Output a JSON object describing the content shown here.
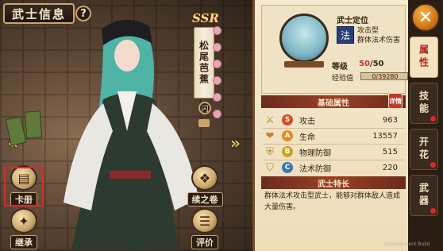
{
  "header": {
    "title": "武士信息",
    "help_label": "?"
  },
  "character": {
    "rarity": "SSR",
    "name": "松尾芭蕉",
    "knot_label": "闪"
  },
  "actions": {
    "card_book": "卡册",
    "inherit": "继承",
    "scroll_continue": "续之卷",
    "evaluate": "评价"
  },
  "profile": {
    "header": "武士定位",
    "type_icon": "法",
    "type_text": "攻击型\n群体法术伤害",
    "level_label": "等级",
    "level_current": "50",
    "level_max": "/50",
    "exp_label": "经验值",
    "exp_value": "0/39280"
  },
  "stats": {
    "title": "基础属性",
    "detail_label": "详情",
    "rows": [
      {
        "icon": "sword-icon",
        "grade": "S",
        "grade_color": "#d64b2a",
        "name": "攻击",
        "value": "963"
      },
      {
        "icon": "heart-icon",
        "grade": "A",
        "grade_color": "#e28b1f",
        "name": "生命",
        "value": "13557"
      },
      {
        "icon": "armor-icon",
        "grade": "B",
        "grade_color": "#d4a11f",
        "name": "物理防御",
        "value": "515"
      },
      {
        "icon": "magic-shield-icon",
        "grade": "C",
        "grade_color": "#3b76b8",
        "name": "法术防御",
        "value": "220"
      }
    ]
  },
  "traits": {
    "title": "武士特长",
    "description": "群体法术攻击型武士，能够对群体敌人造成大量伤害。"
  },
  "tabs": [
    {
      "label": "属性",
      "active": true,
      "dot": false
    },
    {
      "label": "技能",
      "active": false,
      "dot": true
    },
    {
      "label": "开花",
      "active": false,
      "dot": true
    },
    {
      "label": "武器",
      "active": false,
      "dot": true
    }
  ],
  "close_label": "✕",
  "watermark": "Development Build"
}
